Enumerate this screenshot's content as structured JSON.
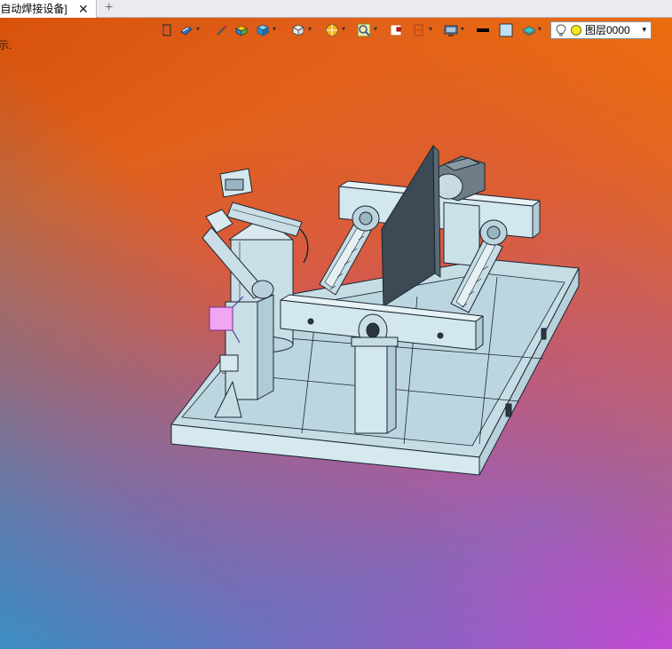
{
  "tab": {
    "title": "[自动焊接设备]",
    "close_glyph": "✕",
    "new_tab_glyph": "+"
  },
  "hint": "示.",
  "toolbar": {
    "icons": [
      "exit-icon",
      "view-orientation-icon",
      "sketch-pen-icon",
      "material-icon",
      "box-solid-icon",
      "box-wire-icon",
      "render-sphere-icon",
      "zoom-fit-icon",
      "section-icon",
      "clip-plane-icon",
      "display-monitor-icon",
      "line-color-icon",
      "fill-color-icon",
      "layer-surface-icon"
    ],
    "dropdown_glyph": "▾"
  },
  "layer_select": {
    "label": "图层0000",
    "light_on": true,
    "dot_color": "#f3e61c",
    "arrow": "▾"
  },
  "colors": {
    "part_fill": "#cfe3ea",
    "part_edge": "#1b2630",
    "panel_dark": "#3b4a55",
    "gripper_pink": "#f0a6f0"
  },
  "model": {
    "name": "automatic-welding-equipment",
    "components": [
      "base-plate",
      "robot-arm",
      "robot-pedestal",
      "cylindrical-column",
      "left-roller",
      "right-roller",
      "center-partition-plate",
      "front-crossbeam",
      "rear-crossbeam",
      "motor-unit",
      "front-post"
    ]
  }
}
